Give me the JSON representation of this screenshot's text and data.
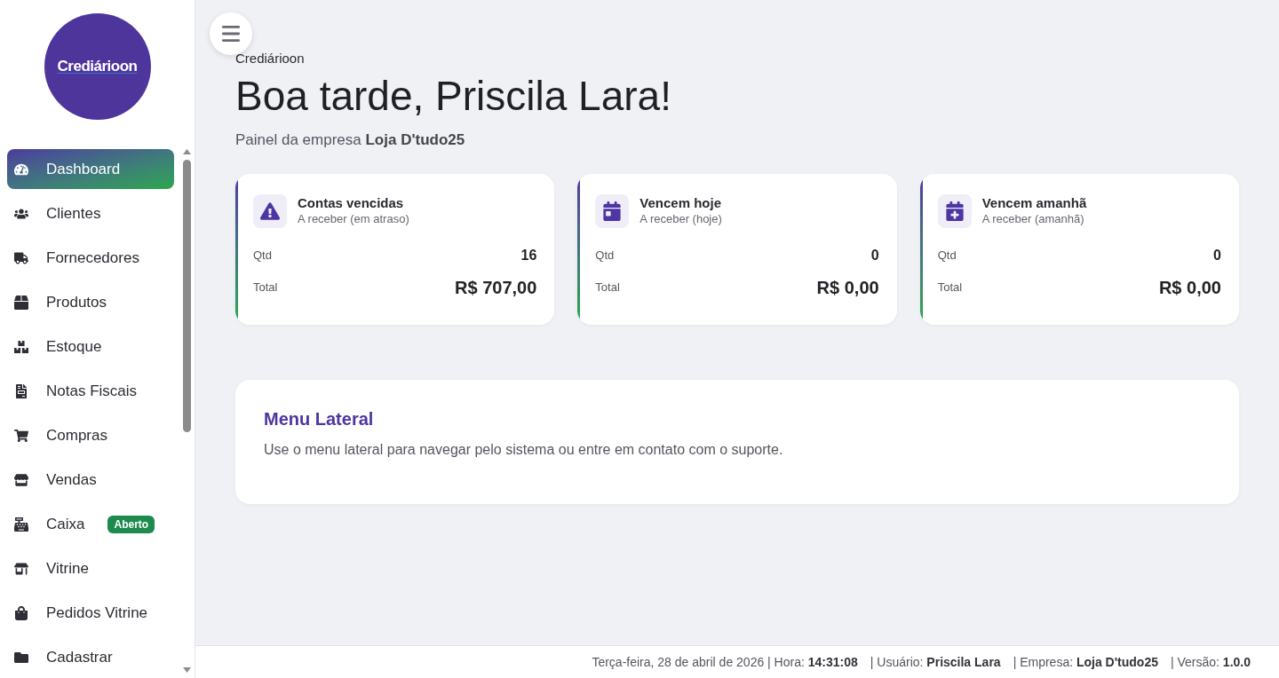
{
  "sidebar": {
    "logo": "Crediárioon",
    "items": [
      {
        "label": "Dashboard",
        "selected": true
      },
      {
        "label": "Clientes",
        "selected": false
      },
      {
        "label": "Fornecedores",
        "selected": false
      },
      {
        "label": "Produtos",
        "selected": false
      },
      {
        "label": "Estoque",
        "selected": false
      },
      {
        "label": "Notas Fiscais",
        "selected": false
      },
      {
        "label": "Compras",
        "selected": false
      },
      {
        "label": "Vendas",
        "selected": false
      },
      {
        "label": "Caixa",
        "selected": false,
        "badge": "Aberto"
      },
      {
        "label": "Vitrine",
        "selected": false
      },
      {
        "label": "Pedidos Vitrine",
        "selected": false
      },
      {
        "label": "Cadastrar",
        "selected": false
      }
    ]
  },
  "header": {
    "brand": "Crediárioon",
    "greeting": "Boa tarde, Priscila Lara!",
    "subtitle": "Painel da empresa **Loja D'tudo25**"
  },
  "cards": [
    {
      "title": "Contas vencidas",
      "subtitle": "A receber (em atraso)",
      "qtd_label": "Qtd",
      "qtd": "16",
      "total_label": "Total",
      "total": "R$ 707,00"
    },
    {
      "title": "Vencem hoje",
      "subtitle": "A receber (hoje)",
      "qtd_label": "Qtd",
      "qtd": "0",
      "total_label": "Total",
      "total": "R$ 0,00"
    },
    {
      "title": "Vencem amanhã",
      "subtitle": "A receber (amanhã)",
      "qtd_label": "Qtd",
      "qtd": "0",
      "total_label": "Total",
      "total": "R$ 0,00"
    }
  ],
  "info_panel": {
    "title": "Menu Lateral",
    "text": "Use o menu lateral para navegar pelo sistema ou entre em contato com o suporte."
  },
  "status_bar": [
    "Terça-feira, 28 de abril de 2026 | Hora: **14:31:08**",
    "| Usuário: **Priscila Lara**",
    "| Empresa: **Loja D'tudo25**",
    "| Versão: **1.0.0**"
  ]
}
